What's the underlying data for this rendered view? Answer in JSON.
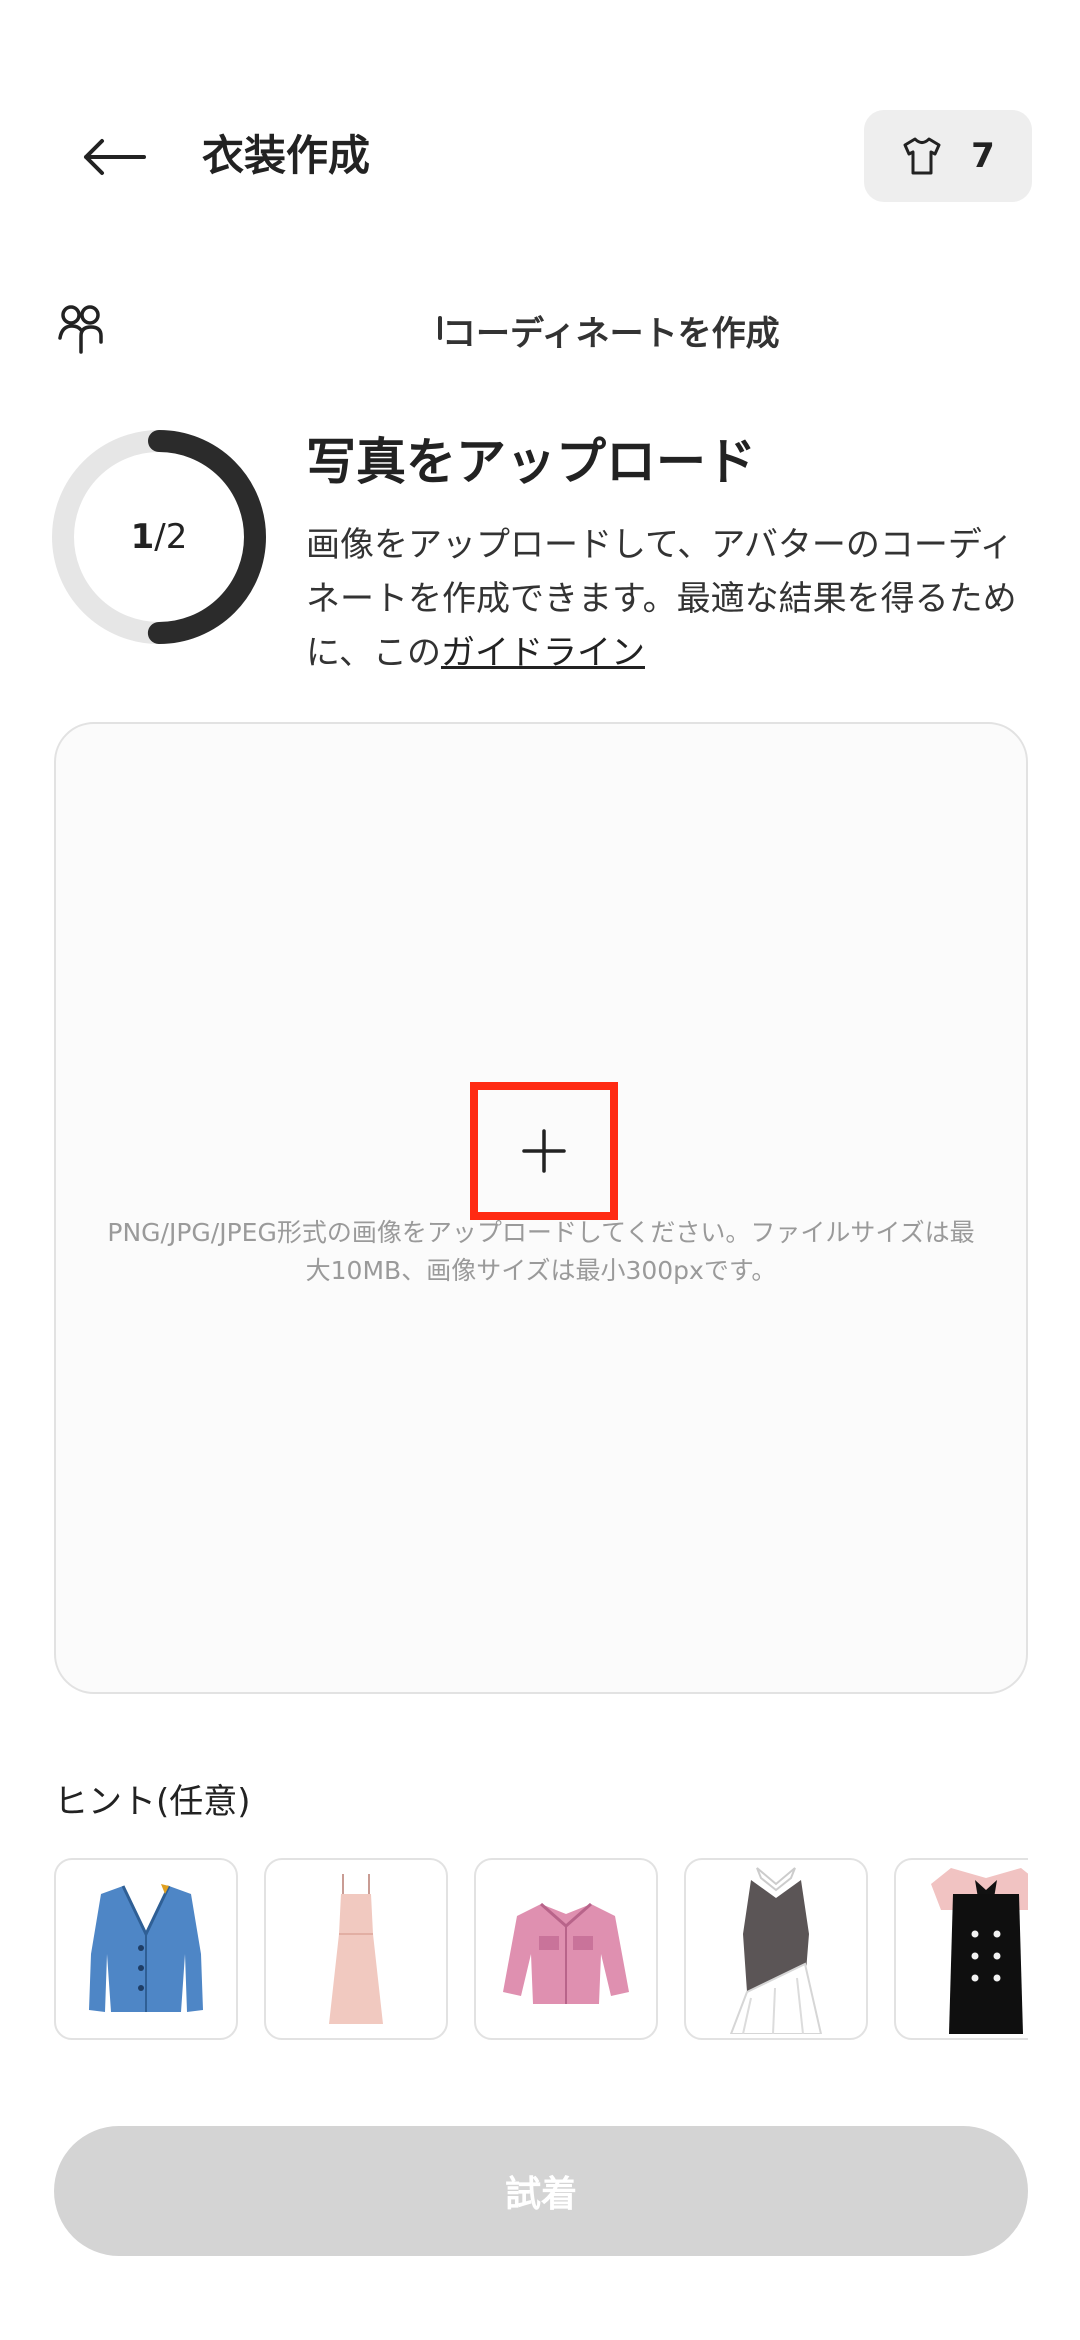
{
  "header": {
    "title": "衣装作成",
    "credits": "7"
  },
  "mode": {
    "label": "コーディネートを作成"
  },
  "step": {
    "progress_current": "1",
    "progress_separator": " / ",
    "progress_total": "2",
    "progress_fraction": 0.5,
    "title": "写真をアップロード",
    "description": "画像をアップロードして、アバターのコーディネートを作成できます。最適な結果を得るために、この",
    "guide_link": "ガイドライン"
  },
  "upload": {
    "hint": "PNG/JPG/JPEG形式の画像をアップロードしてください。ファイルサイズは最大10MB、画像サイズは最小300pxです。"
  },
  "hints": {
    "label": "ヒント(任意)",
    "items": [
      "blue-cardigan",
      "pink-slip-dress",
      "pink-denim-jacket",
      "grey-white-dress",
      "black-pinafore-dress"
    ]
  },
  "action": {
    "tryon_label": "試着"
  },
  "colors": {
    "accent_highlight": "#ff2a12",
    "ring_fill": "#2b2b2b",
    "ring_track": "#e6e6e6",
    "button_disabled": "#d4d4d4"
  }
}
